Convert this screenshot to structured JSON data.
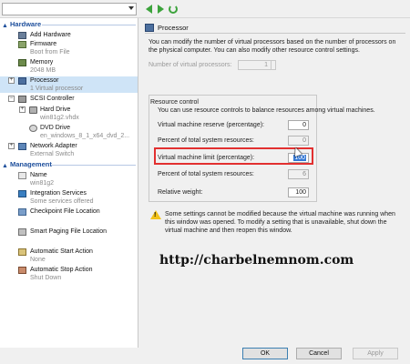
{
  "left": {
    "hardware_heading": "Hardware",
    "management_heading": "Management",
    "items": [
      {
        "label": "Add Hardware",
        "desc": ""
      },
      {
        "label": "Firmware",
        "desc": "Boot from File"
      },
      {
        "label": "Memory",
        "desc": "2048 MB"
      },
      {
        "label": "Processor",
        "desc": "1 Virtual processor"
      },
      {
        "label": "SCSI Controller",
        "desc": ""
      },
      {
        "label": "Hard Drive",
        "desc": "win81g2.vhdx"
      },
      {
        "label": "DVD Drive",
        "desc": "en_windows_8_1_x64_dvd_2..."
      },
      {
        "label": "Network Adapter",
        "desc": "External Switch"
      }
    ],
    "mgmt_items": [
      {
        "label": "Name",
        "desc": "win81g2"
      },
      {
        "label": "Integration Services",
        "desc": "Some services offered"
      },
      {
        "label": "Checkpoint File Location",
        "desc": ""
      },
      {
        "label": "Smart Paging File Location",
        "desc": ""
      },
      {
        "label": "Automatic Start Action",
        "desc": "None"
      },
      {
        "label": "Automatic Stop Action",
        "desc": "Shut Down"
      }
    ]
  },
  "right": {
    "title": "Processor",
    "intro": "You can modify the number of virtual processors based on the number of processors on the physical computer. You can also modify other resource control settings.",
    "num_vp_label": "Number of virtual processors:",
    "num_vp_value": "1",
    "group_title": "Resource control",
    "group_desc": "You can use resource controls to balance resources among virtual machines.",
    "reserve_label": "Virtual machine reserve (percentage):",
    "reserve_value": "0",
    "reserve_pct_label": "Percent of total system resources:",
    "reserve_pct_value": "0",
    "limit_label": "Virtual machine limit (percentage):",
    "limit_value": "100",
    "limit_pct_label": "Percent of total system resources:",
    "limit_pct_value": "6",
    "weight_label": "Relative weight:",
    "weight_value": "100",
    "warning": "Some settings cannot be modified because the virtual machine was running when this window was opened. To modify a setting that is unavailable, shut down the virtual machine and then reopen this window.",
    "watermark": "http://charbelnemnom.com"
  },
  "buttons": {
    "ok": "OK",
    "cancel": "Cancel",
    "apply": "Apply"
  }
}
